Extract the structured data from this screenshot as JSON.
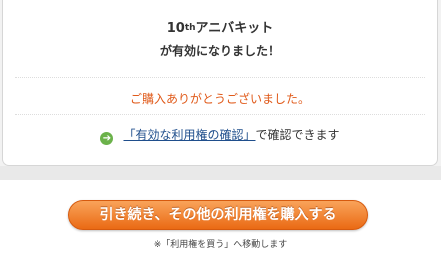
{
  "card": {
    "title_prefix": "10",
    "title_sup": "th",
    "title_rest": "アニバキット",
    "subtitle": "が有効になりました！",
    "thanks": "ご購入ありがとうございました。",
    "confirm_link": "「有効な利用権の確認」",
    "confirm_suffix": "で確認できます"
  },
  "buy_button_label": "引き続き、その他の利用権を購入する",
  "note": "※「利用権を買う」へ移動します",
  "colors": {
    "accent": "#e05a1a",
    "link": "#1f4e8c",
    "arrow_icon": "#6bb24a",
    "button": "#ea6a14"
  }
}
